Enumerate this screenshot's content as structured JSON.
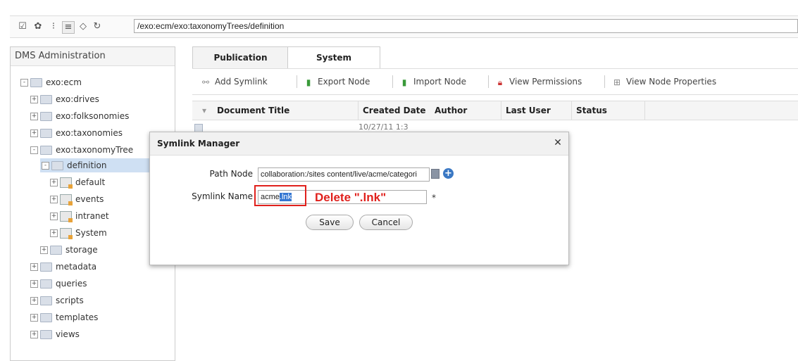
{
  "toolbar": {
    "icons": [
      "edit-icon",
      "settings-icon",
      "view-icon",
      "list-view-icon",
      "back-icon",
      "refresh-icon"
    ],
    "address": "/exo:ecm/exo:taxonomyTrees/definition"
  },
  "left_panel": {
    "title": "DMS Administration",
    "tree": [
      {
        "label": "exo:ecm",
        "kind": "folder",
        "expander": "-"
      },
      {
        "label": "exo:drives",
        "kind": "folder",
        "expander": "+"
      },
      {
        "label": "exo:folksonomies",
        "kind": "folder",
        "expander": "+"
      },
      {
        "label": "exo:taxonomies",
        "kind": "folder",
        "expander": "+"
      },
      {
        "label": "exo:taxonomyTree",
        "kind": "folder-open",
        "expander": "-"
      },
      {
        "label": "definition",
        "kind": "folder-open",
        "expander": "-",
        "selected": true
      },
      {
        "label": "default",
        "kind": "category",
        "expander": "+"
      },
      {
        "label": "events",
        "kind": "category",
        "expander": "+"
      },
      {
        "label": "intranet",
        "kind": "category",
        "expander": "+"
      },
      {
        "label": "System",
        "kind": "category",
        "expander": "+"
      },
      {
        "label": "storage",
        "kind": "folder",
        "expander": "+"
      },
      {
        "label": "metadata",
        "kind": "folder",
        "expander": "+"
      },
      {
        "label": "queries",
        "kind": "folder",
        "expander": "+"
      },
      {
        "label": "scripts",
        "kind": "folder",
        "expander": "+"
      },
      {
        "label": "templates",
        "kind": "folder",
        "expander": "+"
      },
      {
        "label": "views",
        "kind": "folder",
        "expander": "+"
      }
    ]
  },
  "tabs": [
    {
      "label": "Publication",
      "active": false
    },
    {
      "label": "System",
      "active": true
    }
  ],
  "actions": [
    {
      "label": "Add Symlink",
      "icon": "link-icon"
    },
    {
      "label": "Export Node",
      "icon": "export-icon"
    },
    {
      "label": "Import Node",
      "icon": "import-icon"
    },
    {
      "label": "View Permissions",
      "icon": "lock-icon"
    },
    {
      "label": "View Node Properties",
      "icon": "properties-icon"
    }
  ],
  "table": {
    "columns": [
      "Document Title",
      "Created Date",
      "Author",
      "Last User",
      "Status"
    ],
    "partial_row_date": "10/27/11 1:3"
  },
  "dialog": {
    "title": "Symlink Manager",
    "path_label": "Path Node",
    "path_value": "collaboration:/sites content/live/acme/categori",
    "name_label": "Symlink Name",
    "name_value_prefix": "acme",
    "name_value_selected": ".lnk",
    "required_mark": "*",
    "save_label": "Save",
    "cancel_label": "Cancel"
  },
  "annotation": {
    "text": "Delete \".lnk\"",
    "color": "#e0201c"
  }
}
